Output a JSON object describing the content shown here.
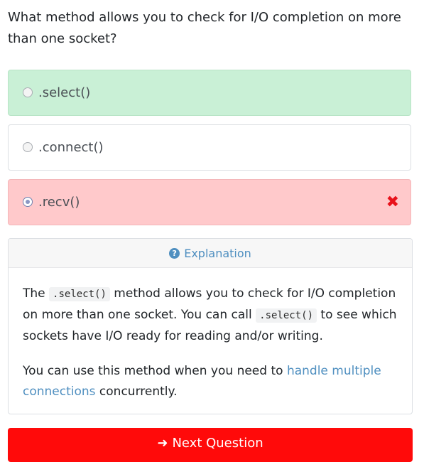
{
  "question": {
    "text": "What method allows you to check for I/O completion on more than one socket?"
  },
  "options": [
    {
      "label": ".select()",
      "state": "correct",
      "selected": false
    },
    {
      "label": ".connect()",
      "state": "neutral",
      "selected": false
    },
    {
      "label": ".recv()",
      "state": "wrong",
      "selected": true,
      "mark": "✖"
    }
  ],
  "explanation": {
    "header_label": "Explanation",
    "p1_a": "The ",
    "p1_code1": ".select()",
    "p1_b": " method allows you to check for I/O completion on more than one socket. You can call ",
    "p1_code2": ".select()",
    "p1_c": " to see which sockets have I/O ready for reading and/or writing.",
    "p2_a": "You can use this method when you need to ",
    "p2_link": "handle multiple connections",
    "p2_b": " concurrently."
  },
  "next_button": {
    "label": "Next Question",
    "icon": "arrow-right-icon"
  },
  "colors": {
    "correct_bg": "#c9f0d6",
    "wrong_bg": "#ffc9cb",
    "accent_link": "#4f8fc0",
    "button_bg": "#ff0a0a",
    "wrong_mark": "#e8121b"
  }
}
